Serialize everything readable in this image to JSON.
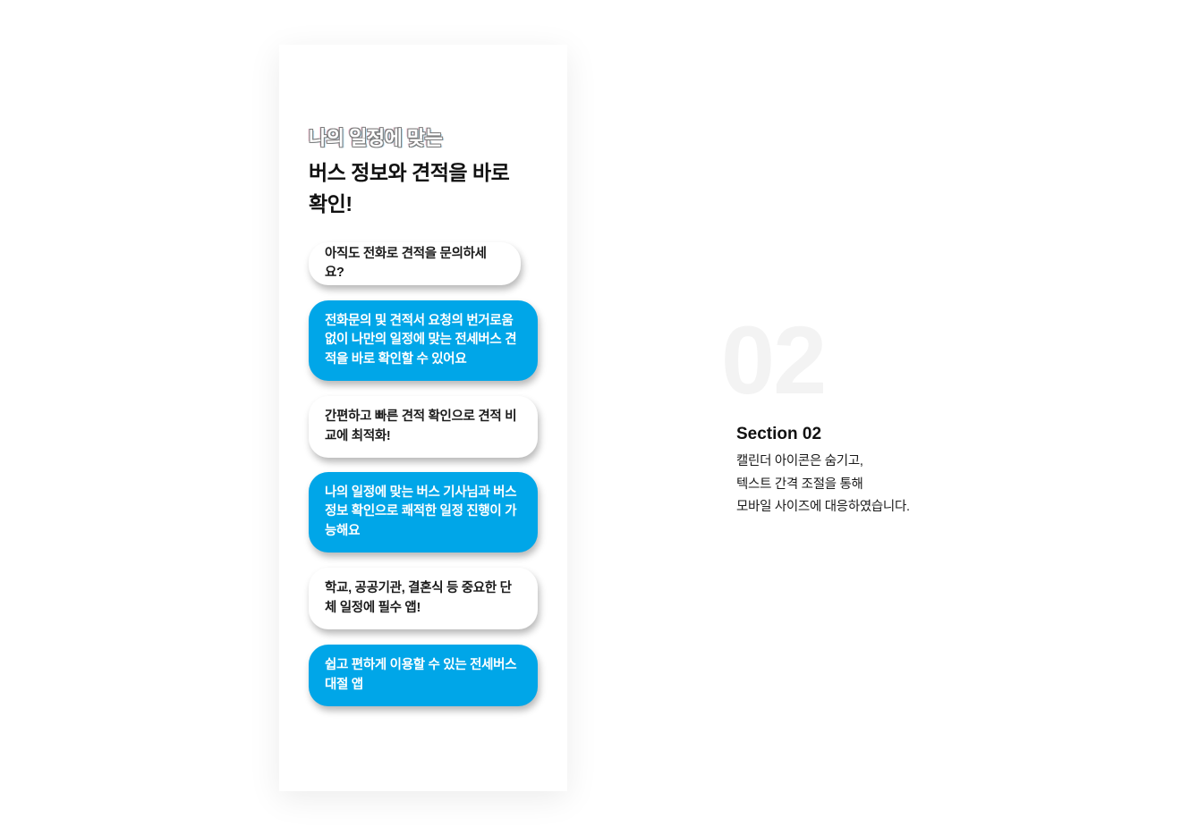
{
  "card": {
    "headline_outline": "나의 일정에 맞는",
    "headline_main": "버스 정보와 견적을 바로\n확인!",
    "bubbles": [
      {
        "text": "아직도 전화로 견적을 문의하세요?",
        "style": "white"
      },
      {
        "text": "전화문의 및 견적서 요청의 번거로움 없이 나만의 일정에 맞는 전세버스 견적을 바로 확인할 수 있어요",
        "style": "blue"
      },
      {
        "text": "간편하고 빠른 견적 확인으로 견적 비교에 최적화!",
        "style": "white"
      },
      {
        "text": "나의 일정에 맞는 버스 기사님과 버스 정보 확인으로 쾌적한 일정 진행이 가능해요",
        "style": "blue"
      },
      {
        "text": "학교, 공공기관, 결혼식 등 중요한 단체 일정에 필수 앱!",
        "style": "white"
      },
      {
        "text": "쉽고 편하게 이용할 수 있는 전세버스 대절 앱",
        "style": "blue"
      }
    ]
  },
  "section": {
    "number": "02",
    "title": "Section 02",
    "description": [
      "캘린더 아이콘은 숨기고,",
      "텍스트 간격 조절을 통해",
      "모바일 사이즈에 대응하였습니다."
    ]
  },
  "colors": {
    "accent_blue": "#00a6e8",
    "bubble_white": "#ffffff",
    "number_watermark": "#f3f3f3"
  }
}
